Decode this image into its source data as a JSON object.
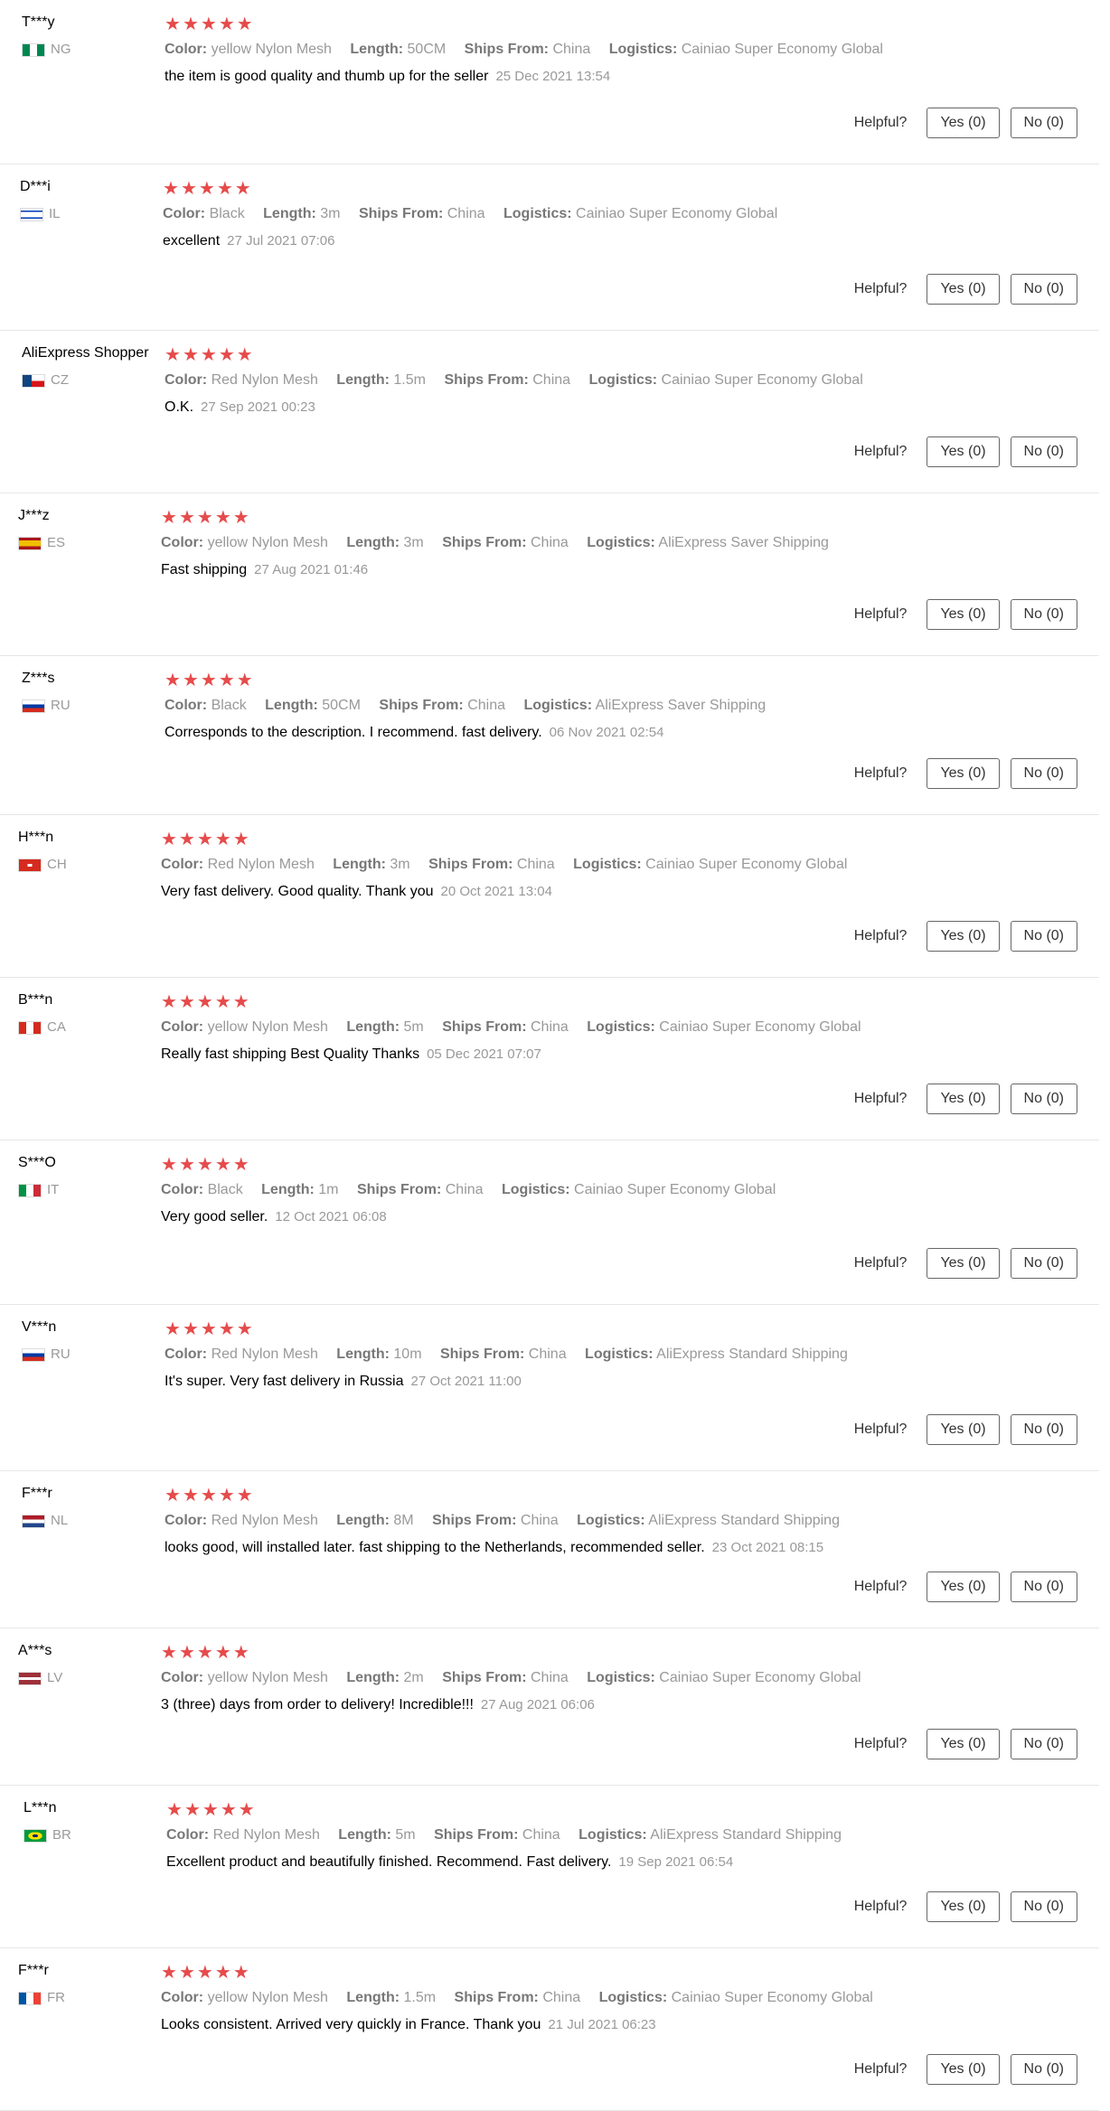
{
  "helpful_label": "Helpful?",
  "attr_labels": {
    "color": "Color:",
    "length": "Length:",
    "ships_from": "Ships From:",
    "logistics": "Logistics:"
  },
  "star_color": "#e64b4b",
  "reviews": [
    {
      "user": "T***y",
      "country": "NG",
      "rating": 5,
      "color": "yellow Nylon Mesh",
      "length": "50CM",
      "ships_from": "China",
      "logistics": "Cainiao Super Economy Global",
      "text": "the item is good quality and thumb up for the seller",
      "date": "25 Dec 2021 13:54",
      "yes": "Yes (0)",
      "no": "No (0)"
    },
    {
      "user": "D***i",
      "country": "IL",
      "rating": 5,
      "color": "Black",
      "length": "3m",
      "ships_from": "China",
      "logistics": "Cainiao Super Economy Global",
      "text": "excellent",
      "date": "27 Jul 2021 07:06",
      "yes": "Yes (0)",
      "no": "No (0)"
    },
    {
      "user": "AliExpress Shopper",
      "country": "CZ",
      "rating": 5,
      "color": "Red Nylon Mesh",
      "length": "1.5m",
      "ships_from": "China",
      "logistics": "Cainiao Super Economy Global",
      "text": "O.K.",
      "date": "27 Sep 2021 00:23",
      "yes": "Yes (0)",
      "no": "No (0)"
    },
    {
      "user": "J***z",
      "country": "ES",
      "rating": 5,
      "color": "yellow Nylon Mesh",
      "length": "3m",
      "ships_from": "China",
      "logistics": "AliExpress Saver Shipping",
      "text": "Fast shipping",
      "date": "27 Aug 2021 01:46",
      "yes": "Yes (0)",
      "no": "No (0)"
    },
    {
      "user": "Z***s",
      "country": "RU",
      "rating": 5,
      "color": "Black",
      "length": "50CM",
      "ships_from": "China",
      "logistics": "AliExpress Saver Shipping",
      "text": "Corresponds to the description. I recommend. fast delivery.",
      "date": "06 Nov 2021 02:54",
      "yes": "Yes (0)",
      "no": "No (0)"
    },
    {
      "user": "H***n",
      "country": "CH",
      "rating": 5,
      "color": "Red Nylon Mesh",
      "length": "3m",
      "ships_from": "China",
      "logistics": "Cainiao Super Economy Global",
      "text": "Very fast delivery. Good quality. Thank you",
      "date": "20 Oct 2021 13:04",
      "yes": "Yes (0)",
      "no": "No (0)"
    },
    {
      "user": "B***n",
      "country": "CA",
      "rating": 5,
      "color": "yellow Nylon Mesh",
      "length": "5m",
      "ships_from": "China",
      "logistics": "Cainiao Super Economy Global",
      "text": "Really fast shipping Best Quality Thanks",
      "date": "05 Dec 2021 07:07",
      "yes": "Yes (0)",
      "no": "No (0)"
    },
    {
      "user": "S***O",
      "country": "IT",
      "rating": 5,
      "color": "Black",
      "length": "1m",
      "ships_from": "China",
      "logistics": "Cainiao Super Economy Global",
      "text": "Very good seller.",
      "date": "12 Oct 2021 06:08",
      "yes": "Yes (0)",
      "no": "No (0)"
    },
    {
      "user": "V***n",
      "country": "RU",
      "rating": 5,
      "color": "Red Nylon Mesh",
      "length": "10m",
      "ships_from": "China",
      "logistics": "AliExpress Standard Shipping",
      "text": "It's super. Very fast delivery in Russia",
      "date": "27 Oct 2021 11:00",
      "yes": "Yes (0)",
      "no": "No (0)"
    },
    {
      "user": "F***r",
      "country": "NL",
      "rating": 5,
      "color": "Red Nylon Mesh",
      "length": "8M",
      "ships_from": "China",
      "logistics": "AliExpress Standard Shipping",
      "text": "looks good, will installed later. fast shipping to the Netherlands, recommended seller.",
      "date": "23 Oct 2021 08:15",
      "yes": "Yes (0)",
      "no": "No (0)"
    },
    {
      "user": "A***s",
      "country": "LV",
      "rating": 5,
      "color": "yellow Nylon Mesh",
      "length": "2m",
      "ships_from": "China",
      "logistics": "Cainiao Super Economy Global",
      "text": "3 (three) days from order to delivery! Incredible!!!",
      "date": "27 Aug 2021 06:06",
      "yes": "Yes (0)",
      "no": "No (0)"
    },
    {
      "user": "L***n",
      "country": "BR",
      "rating": 5,
      "color": "Red Nylon Mesh",
      "length": "5m",
      "ships_from": "China",
      "logistics": "AliExpress Standard Shipping",
      "text": "Excellent product and beautifully finished. Recommend. Fast delivery.",
      "date": "19 Sep 2021 06:54",
      "yes": "Yes (0)",
      "no": "No (0)"
    },
    {
      "user": "F***r",
      "country": "FR",
      "rating": 5,
      "color": "yellow Nylon Mesh",
      "length": "1.5m",
      "ships_from": "China",
      "logistics": "Cainiao Super Economy Global",
      "text": "Looks consistent. Arrived very quickly in France. Thank you",
      "date": "21 Jul 2021 06:23",
      "yes": "Yes (0)",
      "no": "No (0)"
    }
  ],
  "flag_colors": {
    "NG": [
      "#008751",
      "#ffffff",
      "#008751"
    ],
    "IL": [
      "#ffffff",
      "#0038b8",
      "#ffffff"
    ],
    "CZ": [
      "#ffffff",
      "#d7141a",
      "#11457e"
    ],
    "ES": [
      "#aa151b",
      "#f1bf00",
      "#aa151b"
    ],
    "RU": [
      "#ffffff",
      "#0039a6",
      "#d52b1e"
    ],
    "CH": [
      "#d52b1e",
      "#ffffff",
      "#d52b1e"
    ],
    "CA": [
      "#d52b1e",
      "#ffffff",
      "#d52b1e"
    ],
    "IT": [
      "#009246",
      "#ffffff",
      "#ce2b37"
    ],
    "NL": [
      "#ae1c28",
      "#ffffff",
      "#21468b"
    ],
    "LV": [
      "#9e3039",
      "#ffffff",
      "#9e3039"
    ],
    "BR": [
      "#009c3b",
      "#ffdf00",
      "#009c3b"
    ],
    "FR": [
      "#0055a4",
      "#ffffff",
      "#ef4135"
    ]
  }
}
